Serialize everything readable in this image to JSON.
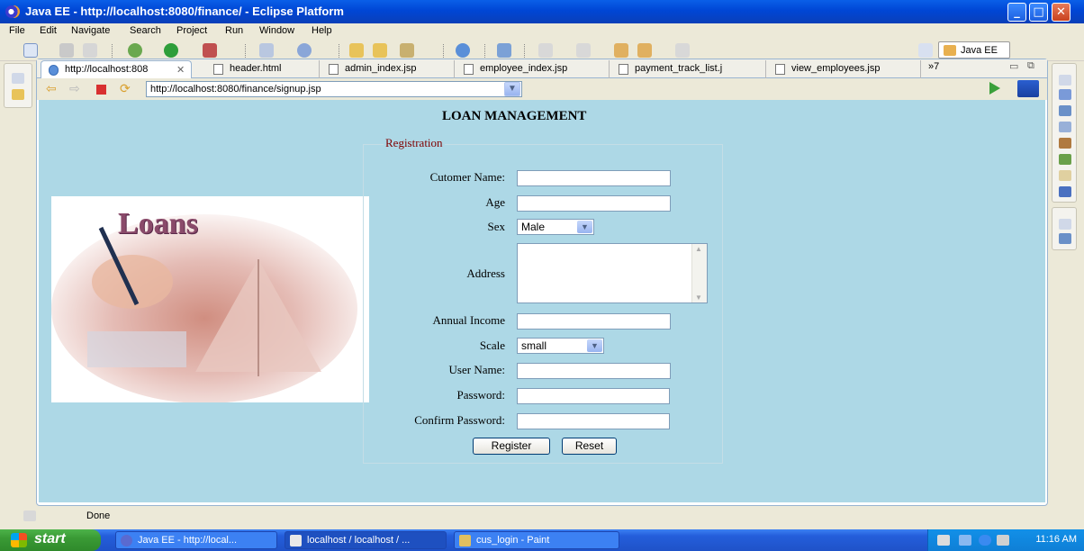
{
  "window": {
    "title": "Java EE - http://localhost:8080/finance/ - Eclipse Platform"
  },
  "menu": [
    "File",
    "Edit",
    "Navigate",
    "Search",
    "Project",
    "Run",
    "Window",
    "Help"
  ],
  "perspective": {
    "label": "Java EE"
  },
  "tabs": [
    {
      "label": "http://localhost:808"
    },
    {
      "label": "header.html"
    },
    {
      "label": "admin_index.jsp"
    },
    {
      "label": "employee_index.jsp"
    },
    {
      "label": "payment_track_list.j"
    },
    {
      "label": "view_employees.jsp"
    }
  ],
  "tabs_overflow": "»7",
  "browser": {
    "url": "http://localhost:8080/finance/signup.jsp"
  },
  "page": {
    "heading": "LOAN MANAGEMENT",
    "legend": "Registration",
    "image_text": "Loans",
    "labels": {
      "name": "Cutomer Name:",
      "age": "Age",
      "sex": "Sex",
      "address": "Address",
      "income": "Annual Income",
      "scale": "Scale",
      "username": "User Name:",
      "password": "Password:",
      "confirm": "Confirm Password:"
    },
    "sex_value": "Male",
    "scale_value": "small",
    "buttons": {
      "register": "Register",
      "reset": "Reset"
    }
  },
  "status": {
    "text": "Done"
  },
  "taskbar": {
    "start": "start",
    "tasks": [
      "Java EE - http://local...",
      "localhost / localhost / ...",
      "cus_login - Paint"
    ],
    "clock": "11:16 AM"
  },
  "colors": {
    "page_bg": "#add8e6",
    "legend": "#800000",
    "titlebar": "#0046d5"
  }
}
